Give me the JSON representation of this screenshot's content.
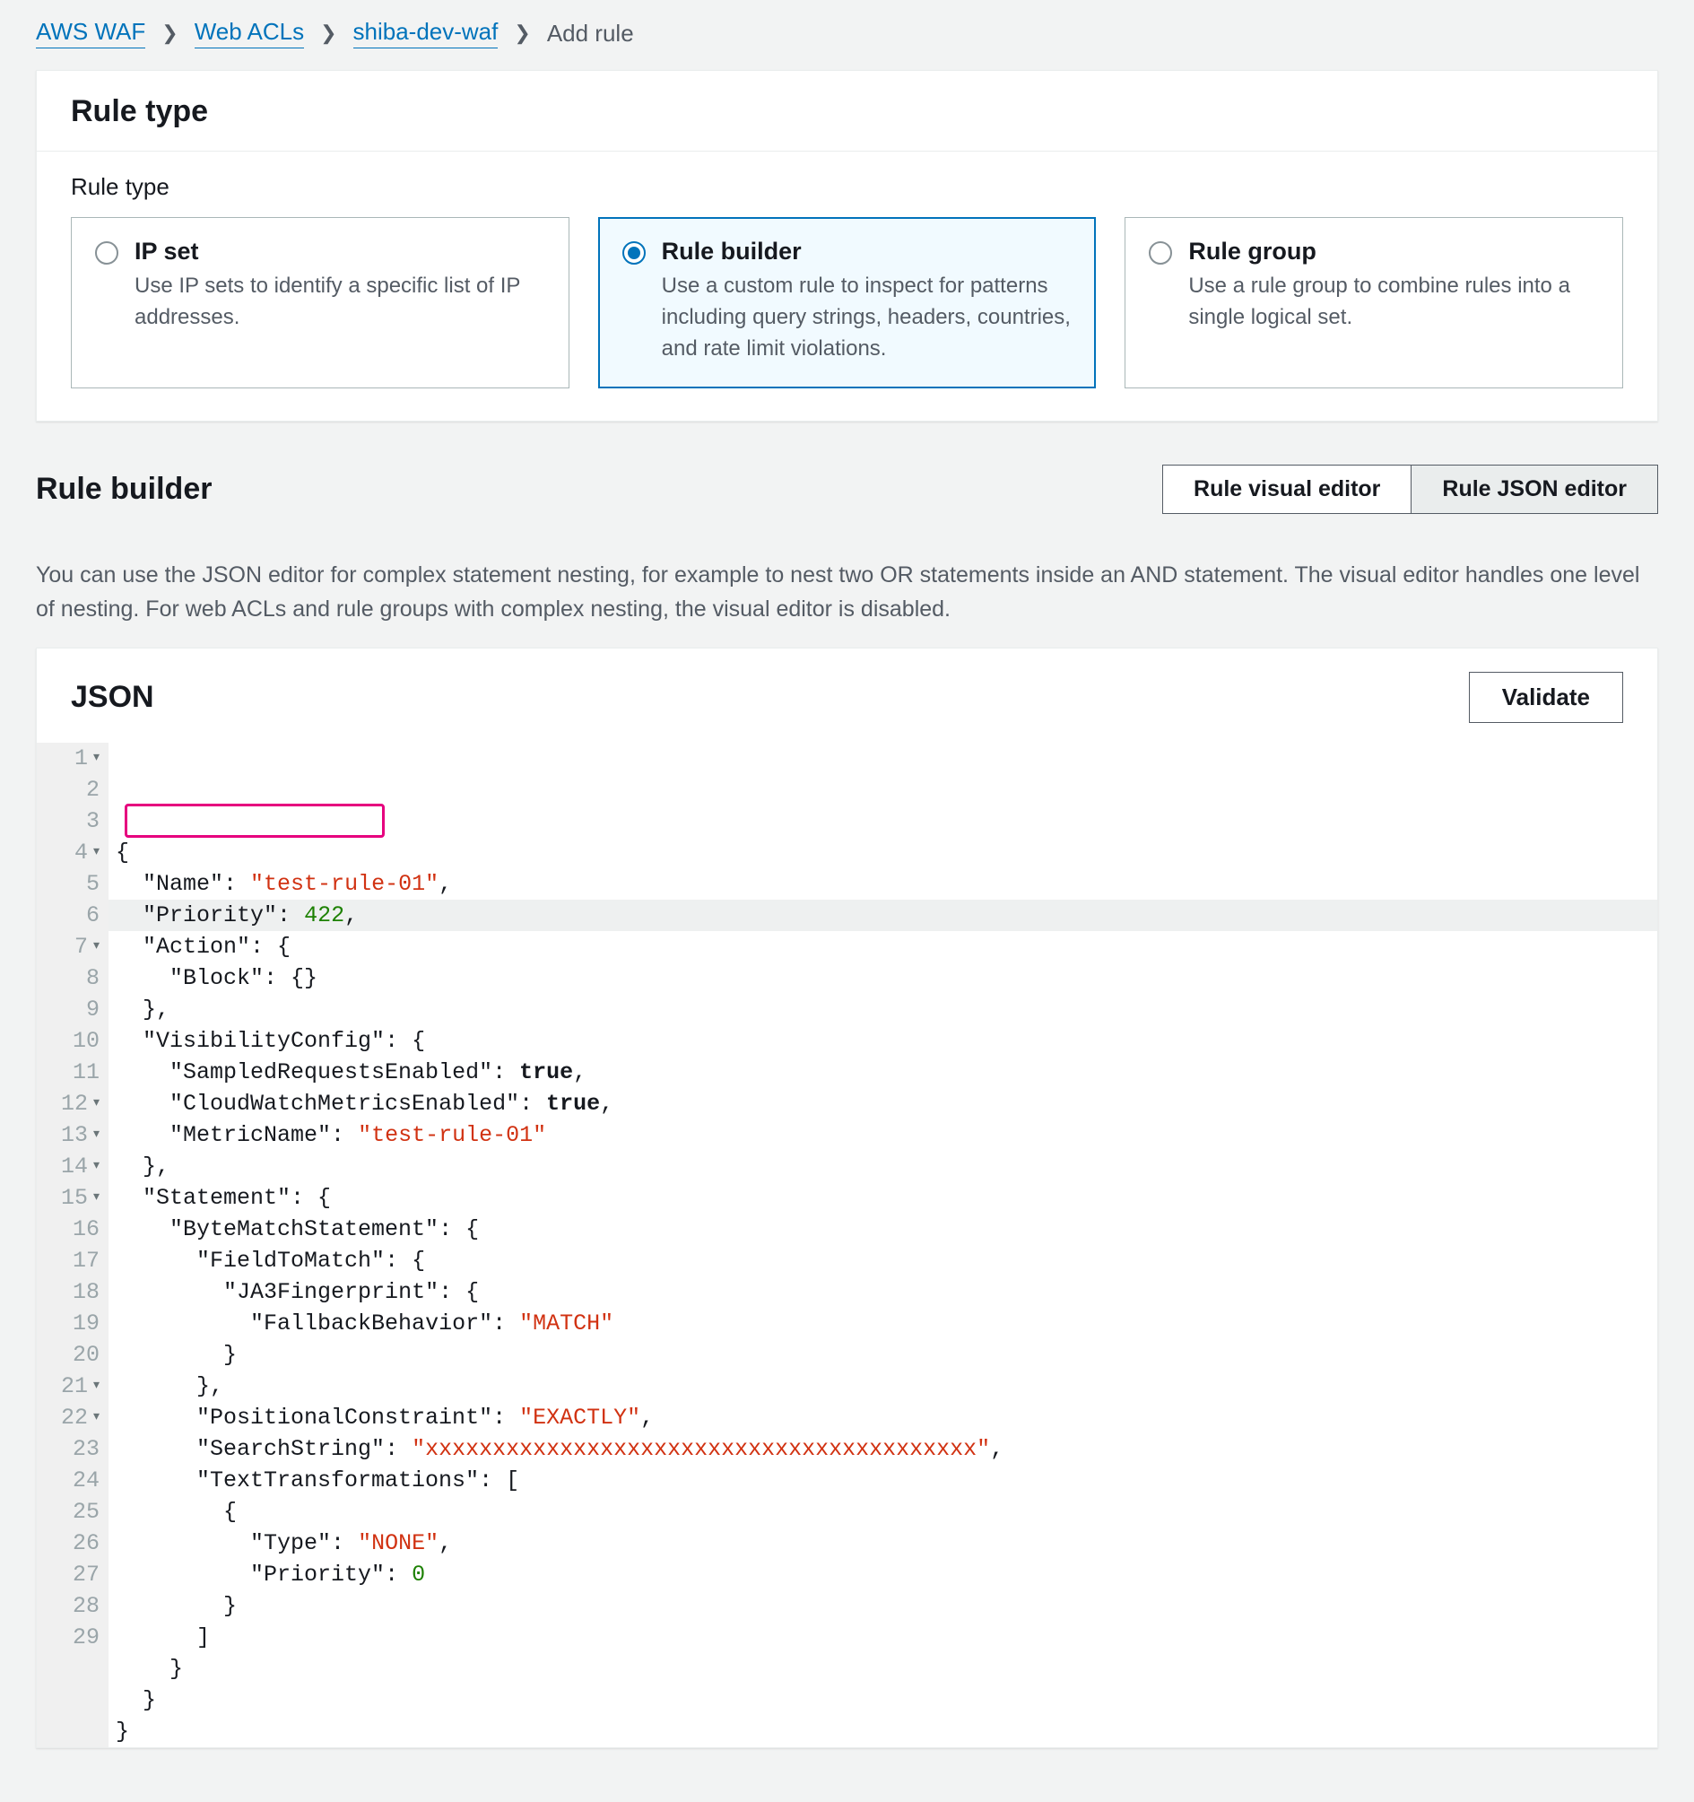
{
  "breadcrumb": {
    "items": [
      {
        "label": "AWS WAF",
        "link": true
      },
      {
        "label": "Web ACLs",
        "link": true
      },
      {
        "label": "shiba-dev-waf",
        "link": true
      },
      {
        "label": "Add rule",
        "link": false
      }
    ]
  },
  "ruleTypePanel": {
    "title": "Rule type",
    "subheading": "Rule type",
    "options": [
      {
        "id": "ip-set",
        "title": "IP set",
        "desc": "Use IP sets to identify a specific list of IP addresses.",
        "selected": false
      },
      {
        "id": "rule-builder",
        "title": "Rule builder",
        "desc": "Use a custom rule to inspect for patterns including query strings, headers, countries, and rate limit violations.",
        "selected": true
      },
      {
        "id": "rule-group",
        "title": "Rule group",
        "desc": "Use a rule group to combine rules into a single logical set.",
        "selected": false
      }
    ]
  },
  "builderSection": {
    "title": "Rule builder",
    "tabs": {
      "visual": "Rule visual editor",
      "json": "Rule JSON editor",
      "active": "json"
    },
    "helpText": "You can use the JSON editor for complex statement nesting, for example to nest two OR statements inside an AND statement. The visual editor handles one level of nesting. For web ACLs and rule groups with complex nesting, the visual editor is disabled."
  },
  "jsonPanel": {
    "title": "JSON",
    "validateLabel": "Validate",
    "lines": [
      {
        "n": 1,
        "fold": true,
        "hl": false,
        "t": [
          [
            "punc",
            "{"
          ]
        ]
      },
      {
        "n": 2,
        "fold": false,
        "hl": false,
        "t": [
          [
            "ind",
            "  "
          ],
          [
            "key",
            "\"Name\""
          ],
          [
            "punc",
            ": "
          ],
          [
            "str",
            "\"test-rule-01\""
          ],
          [
            "punc",
            ","
          ]
        ]
      },
      {
        "n": 3,
        "fold": false,
        "hl": true,
        "t": [
          [
            "ind",
            "  "
          ],
          [
            "key",
            "\"Priority\""
          ],
          [
            "punc",
            ": "
          ],
          [
            "num",
            "422"
          ],
          [
            "punc",
            ","
          ]
        ]
      },
      {
        "n": 4,
        "fold": true,
        "hl": false,
        "t": [
          [
            "ind",
            "  "
          ],
          [
            "key",
            "\"Action\""
          ],
          [
            "punc",
            ": {"
          ]
        ]
      },
      {
        "n": 5,
        "fold": false,
        "hl": false,
        "t": [
          [
            "ind",
            "    "
          ],
          [
            "key",
            "\"Block\""
          ],
          [
            "punc",
            ": {}"
          ]
        ]
      },
      {
        "n": 6,
        "fold": false,
        "hl": false,
        "t": [
          [
            "ind",
            "  "
          ],
          [
            "punc",
            "},"
          ]
        ]
      },
      {
        "n": 7,
        "fold": true,
        "hl": false,
        "t": [
          [
            "ind",
            "  "
          ],
          [
            "key",
            "\"VisibilityConfig\""
          ],
          [
            "punc",
            ": {"
          ]
        ]
      },
      {
        "n": 8,
        "fold": false,
        "hl": false,
        "t": [
          [
            "ind",
            "    "
          ],
          [
            "key",
            "\"SampledRequestsEnabled\""
          ],
          [
            "punc",
            ": "
          ],
          [
            "bool",
            "true"
          ],
          [
            "punc",
            ","
          ]
        ]
      },
      {
        "n": 9,
        "fold": false,
        "hl": false,
        "t": [
          [
            "ind",
            "    "
          ],
          [
            "key",
            "\"CloudWatchMetricsEnabled\""
          ],
          [
            "punc",
            ": "
          ],
          [
            "bool",
            "true"
          ],
          [
            "punc",
            ","
          ]
        ]
      },
      {
        "n": 10,
        "fold": false,
        "hl": false,
        "t": [
          [
            "ind",
            "    "
          ],
          [
            "key",
            "\"MetricName\""
          ],
          [
            "punc",
            ": "
          ],
          [
            "str",
            "\"test-rule-01\""
          ]
        ]
      },
      {
        "n": 11,
        "fold": false,
        "hl": false,
        "t": [
          [
            "ind",
            "  "
          ],
          [
            "punc",
            "},"
          ]
        ]
      },
      {
        "n": 12,
        "fold": true,
        "hl": false,
        "t": [
          [
            "ind",
            "  "
          ],
          [
            "key",
            "\"Statement\""
          ],
          [
            "punc",
            ": {"
          ]
        ]
      },
      {
        "n": 13,
        "fold": true,
        "hl": false,
        "t": [
          [
            "ind",
            "    "
          ],
          [
            "key",
            "\"ByteMatchStatement\""
          ],
          [
            "punc",
            ": {"
          ]
        ]
      },
      {
        "n": 14,
        "fold": true,
        "hl": false,
        "t": [
          [
            "ind",
            "      "
          ],
          [
            "key",
            "\"FieldToMatch\""
          ],
          [
            "punc",
            ": {"
          ]
        ]
      },
      {
        "n": 15,
        "fold": true,
        "hl": false,
        "t": [
          [
            "ind",
            "        "
          ],
          [
            "key",
            "\"JA3Fingerprint\""
          ],
          [
            "punc",
            ": {"
          ]
        ]
      },
      {
        "n": 16,
        "fold": false,
        "hl": false,
        "t": [
          [
            "ind",
            "          "
          ],
          [
            "key",
            "\"FallbackBehavior\""
          ],
          [
            "punc",
            ": "
          ],
          [
            "str",
            "\"MATCH\""
          ]
        ]
      },
      {
        "n": 17,
        "fold": false,
        "hl": false,
        "t": [
          [
            "ind",
            "        "
          ],
          [
            "punc",
            "}"
          ]
        ]
      },
      {
        "n": 18,
        "fold": false,
        "hl": false,
        "t": [
          [
            "ind",
            "      "
          ],
          [
            "punc",
            "},"
          ]
        ]
      },
      {
        "n": 19,
        "fold": false,
        "hl": false,
        "t": [
          [
            "ind",
            "      "
          ],
          [
            "key",
            "\"PositionalConstraint\""
          ],
          [
            "punc",
            ": "
          ],
          [
            "str",
            "\"EXACTLY\""
          ],
          [
            "punc",
            ","
          ]
        ]
      },
      {
        "n": 20,
        "fold": false,
        "hl": false,
        "t": [
          [
            "ind",
            "      "
          ],
          [
            "key",
            "\"SearchString\""
          ],
          [
            "punc",
            ": "
          ],
          [
            "str",
            "\"xxxxxxxxxxxxxxxxxxxxxxxxxxxxxxxxxxxxxxxxx\""
          ],
          [
            "punc",
            ","
          ]
        ]
      },
      {
        "n": 21,
        "fold": true,
        "hl": false,
        "t": [
          [
            "ind",
            "      "
          ],
          [
            "key",
            "\"TextTransformations\""
          ],
          [
            "punc",
            ": ["
          ]
        ]
      },
      {
        "n": 22,
        "fold": true,
        "hl": false,
        "t": [
          [
            "ind",
            "        "
          ],
          [
            "punc",
            "{"
          ]
        ]
      },
      {
        "n": 23,
        "fold": false,
        "hl": false,
        "t": [
          [
            "ind",
            "          "
          ],
          [
            "key",
            "\"Type\""
          ],
          [
            "punc",
            ": "
          ],
          [
            "str",
            "\"NONE\""
          ],
          [
            "punc",
            ","
          ]
        ]
      },
      {
        "n": 24,
        "fold": false,
        "hl": false,
        "t": [
          [
            "ind",
            "          "
          ],
          [
            "key",
            "\"Priority\""
          ],
          [
            "punc",
            ": "
          ],
          [
            "num",
            "0"
          ]
        ]
      },
      {
        "n": 25,
        "fold": false,
        "hl": false,
        "t": [
          [
            "ind",
            "        "
          ],
          [
            "punc",
            "}"
          ]
        ]
      },
      {
        "n": 26,
        "fold": false,
        "hl": false,
        "t": [
          [
            "ind",
            "      "
          ],
          [
            "punc",
            "]"
          ]
        ]
      },
      {
        "n": 27,
        "fold": false,
        "hl": false,
        "t": [
          [
            "ind",
            "    "
          ],
          [
            "punc",
            "}"
          ]
        ]
      },
      {
        "n": 28,
        "fold": false,
        "hl": false,
        "t": [
          [
            "ind",
            "  "
          ],
          [
            "punc",
            "}"
          ]
        ]
      },
      {
        "n": 29,
        "fold": false,
        "hl": false,
        "t": [
          [
            "punc",
            "}"
          ]
        ]
      }
    ],
    "highlightLine": 3
  }
}
